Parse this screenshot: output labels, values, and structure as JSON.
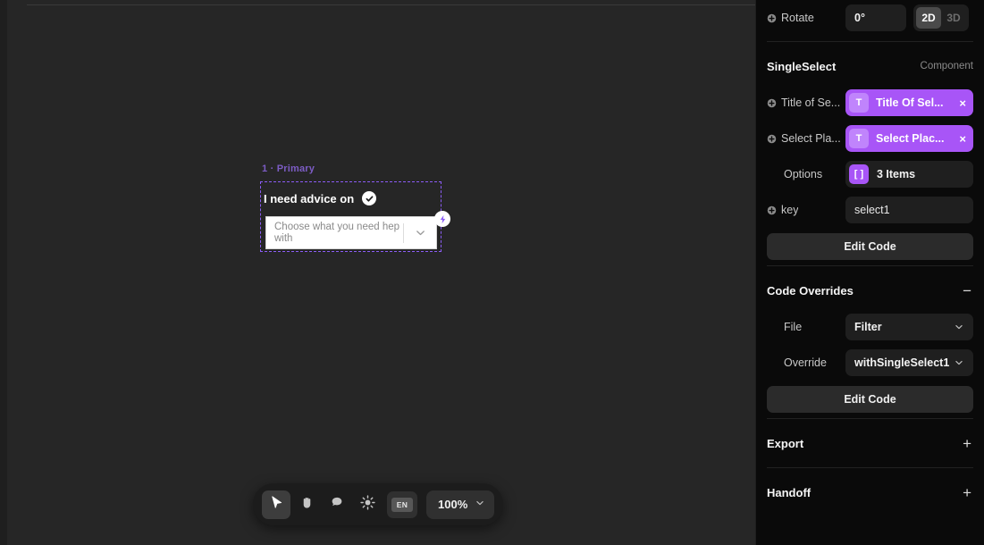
{
  "canvas": {
    "artboard_label": "1 · Primary",
    "component": {
      "title": "I need advice on",
      "check_icon": "check-circle-icon",
      "bolt_icon": "lightning-bolt-icon",
      "select_placeholder": "Choose what you need hep with",
      "chevron_icon": "chevron-down-icon"
    }
  },
  "toolbar": {
    "tools": [
      {
        "name": "cursor-tool",
        "icon": "cursor-arrow-icon",
        "active": true
      },
      {
        "name": "hand-tool",
        "icon": "hand-icon",
        "active": false
      },
      {
        "name": "comment-tool",
        "icon": "comment-bubble-icon",
        "active": false
      },
      {
        "name": "theme-tool",
        "icon": "sun-brightness-icon",
        "active": false
      }
    ],
    "language_badge": "EN",
    "zoom_level": "100%",
    "zoom_chevron_icon": "chevron-down-icon"
  },
  "panel": {
    "rotate": {
      "label": "Rotate",
      "value": "0°",
      "modes": [
        {
          "label": "2D",
          "active": true
        },
        {
          "label": "3D",
          "active": false
        }
      ]
    },
    "component_section": {
      "title": "SingleSelect",
      "meta": "Component",
      "props": [
        {
          "label": "Title of Se...",
          "has_plus": true,
          "kind": "chip",
          "icon_text": "T",
          "value": "Title Of Sel...",
          "close": "×"
        },
        {
          "label": "Select Pla...",
          "has_plus": true,
          "kind": "chip",
          "icon_text": "T",
          "value": "Select Plac...",
          "close": "×"
        },
        {
          "label": "Options",
          "has_plus": false,
          "kind": "options",
          "icon_text": "[ ]",
          "value": "3 Items"
        },
        {
          "label": "key",
          "has_plus": true,
          "kind": "text",
          "value": "select1"
        }
      ],
      "edit_code_label": "Edit Code"
    },
    "code_overrides": {
      "title": "Code Overrides",
      "toggle": "−",
      "file_label": "File",
      "file_value": "Filter",
      "override_label": "Override",
      "override_value": "withSingleSelect1",
      "edit_code_label": "Edit Code"
    },
    "export": {
      "title": "Export",
      "toggle": "+"
    },
    "handoff": {
      "title": "Handoff",
      "toggle": "+"
    }
  }
}
